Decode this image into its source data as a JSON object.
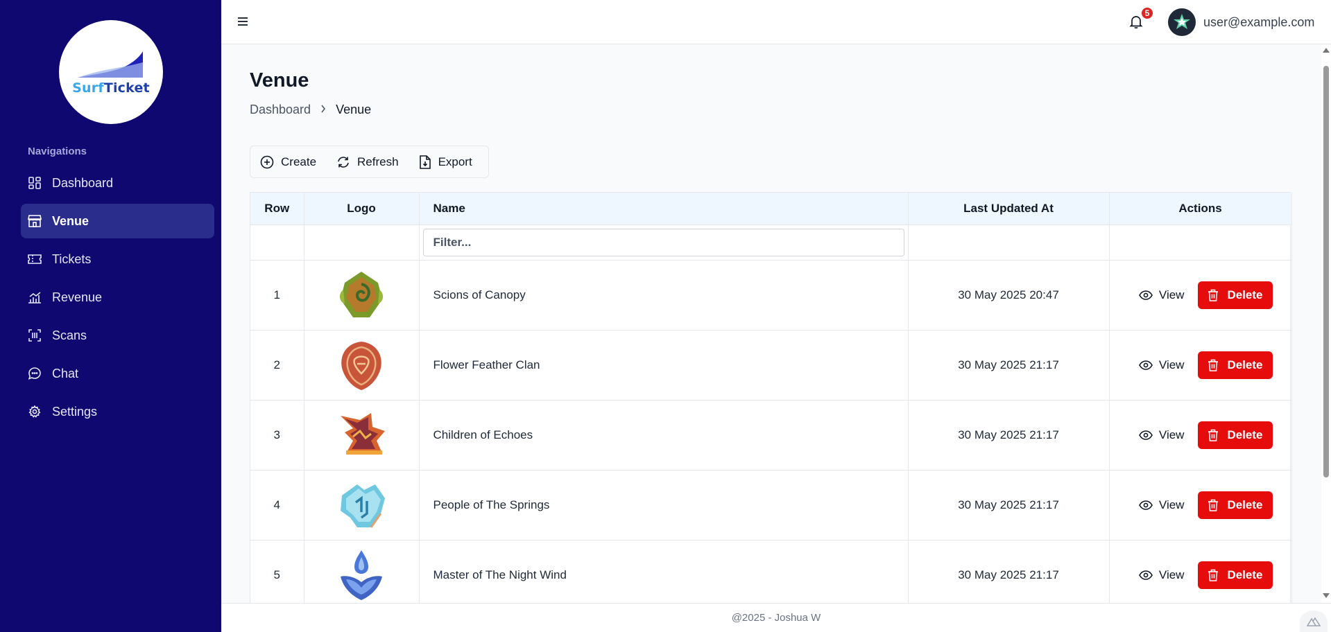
{
  "brand": {
    "surf": "Surf",
    "ticket": "Ticket"
  },
  "sidebar": {
    "heading": "Navigations",
    "items": [
      {
        "label": "Dashboard",
        "icon": "dashboard-icon"
      },
      {
        "label": "Venue",
        "icon": "store-icon",
        "active": true
      },
      {
        "label": "Tickets",
        "icon": "ticket-icon"
      },
      {
        "label": "Revenue",
        "icon": "chart-icon"
      },
      {
        "label": "Scans",
        "icon": "scan-icon"
      },
      {
        "label": "Chat",
        "icon": "chat-icon"
      },
      {
        "label": "Settings",
        "icon": "gear-icon"
      }
    ]
  },
  "header": {
    "notification_count": "5",
    "user_email": "user@example.com"
  },
  "page": {
    "title": "Venue",
    "breadcrumb": {
      "parent": "Dashboard",
      "current": "Venue"
    }
  },
  "toolbar": {
    "create_label": "Create",
    "refresh_label": "Refresh",
    "export_label": "Export"
  },
  "table": {
    "columns": {
      "row": "Row",
      "logo": "Logo",
      "name": "Name",
      "updated": "Last Updated At",
      "actions": "Actions"
    },
    "filter_placeholder": "Filter...",
    "view_label": "View",
    "delete_label": "Delete",
    "rows": [
      {
        "row": "1",
        "name": "Scions of Canopy",
        "updated": "30 May 2025 20:47"
      },
      {
        "row": "2",
        "name": "Flower Feather Clan",
        "updated": "30 May 2025 21:17"
      },
      {
        "row": "3",
        "name": "Children of Echoes",
        "updated": "30 May 2025 21:17"
      },
      {
        "row": "4",
        "name": "People of The Springs",
        "updated": "30 May 2025 21:17"
      },
      {
        "row": "5",
        "name": "Master of The Night Wind",
        "updated": "30 May 2025 21:17"
      }
    ]
  },
  "footer": {
    "text": "@2025 - Joshua W"
  },
  "colors": {
    "sidebar": "#0f0870",
    "active_nav": "#2a2d8c",
    "delete": "#e70c0c",
    "header_row": "#eef6ff"
  }
}
